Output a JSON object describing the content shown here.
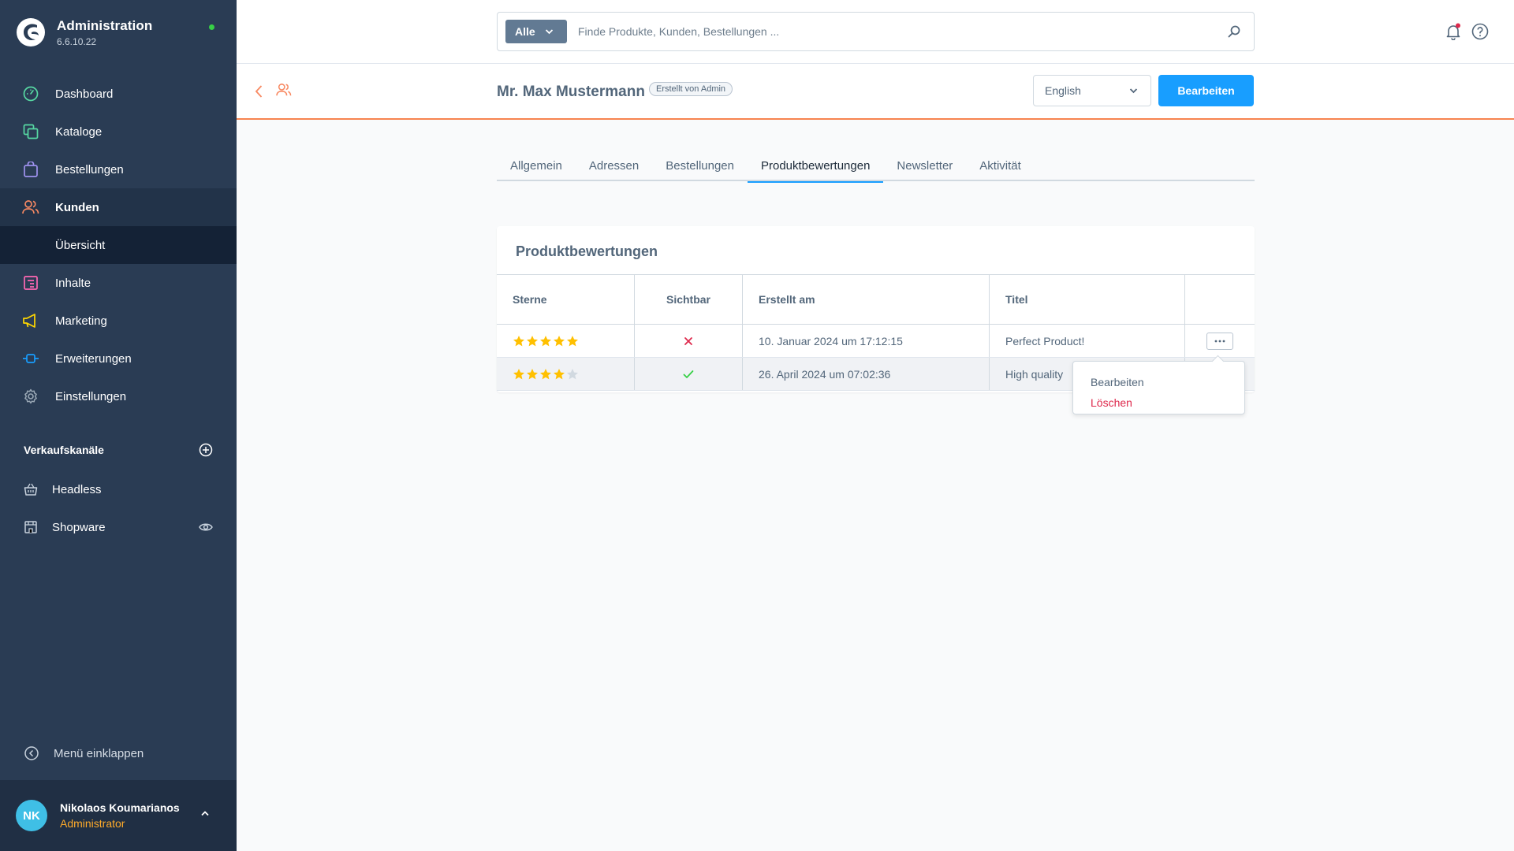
{
  "app": {
    "title": "Administration",
    "version": "6.6.10.22"
  },
  "sidebar": {
    "items": [
      {
        "label": "Dashboard",
        "icon": "dashboard-icon",
        "color": "#57d9a3"
      },
      {
        "label": "Kataloge",
        "icon": "catalog-icon",
        "color": "#57d9a3"
      },
      {
        "label": "Bestellungen",
        "icon": "orders-icon",
        "color": "#a092f0"
      },
      {
        "label": "Kunden",
        "icon": "customers-icon",
        "color": "#f88962"
      },
      {
        "label": "Inhalte",
        "icon": "content-icon",
        "color": "#ff68b4"
      },
      {
        "label": "Marketing",
        "icon": "marketing-icon",
        "color": "#ffd700"
      },
      {
        "label": "Erweiterungen",
        "icon": "extensions-icon",
        "color": "#189eff"
      },
      {
        "label": "Einstellungen",
        "icon": "settings-icon",
        "color": "#9aa8b5"
      }
    ],
    "sub_item": "Übersicht",
    "sales_channels_title": "Verkaufskanäle",
    "channels": [
      {
        "label": "Headless",
        "icon": "basket-icon"
      },
      {
        "label": "Shopware",
        "icon": "storefront-icon"
      }
    ],
    "collapse_label": "Menü einklappen",
    "user": {
      "initials": "NK",
      "name": "Nikolaos Koumarianos",
      "role": "Administrator"
    }
  },
  "search": {
    "type_label": "Alle",
    "placeholder": "Finde Produkte, Kunden, Bestellungen ..."
  },
  "header": {
    "title": "Mr. Max Mustermann",
    "badge": "Erstellt von Admin",
    "language": "English",
    "edit_label": "Bearbeiten"
  },
  "tabs": [
    {
      "label": "Allgemein"
    },
    {
      "label": "Adressen"
    },
    {
      "label": "Bestellungen"
    },
    {
      "label": "Produktbewertungen",
      "active": true
    },
    {
      "label": "Newsletter"
    },
    {
      "label": "Aktivität"
    }
  ],
  "reviews": {
    "title": "Produktbewertungen",
    "columns": [
      "Sterne",
      "Sichtbar",
      "Erstellt am",
      "Titel",
      ""
    ],
    "rows": [
      {
        "stars": 5,
        "visible": false,
        "created": "10. Januar 2024 um 17:12:15",
        "title": "Perfect Product!"
      },
      {
        "stars": 4,
        "visible": true,
        "created": "26. April 2024 um 07:02:36",
        "title": "High quality"
      }
    ]
  },
  "context_menu": {
    "edit": "Bearbeiten",
    "delete": "Löschen"
  },
  "colors": {
    "accent": "#189eff",
    "star": "#ffc000",
    "star_empty": "#d1d9e0",
    "danger": "#de294c",
    "success": "#37d046"
  }
}
